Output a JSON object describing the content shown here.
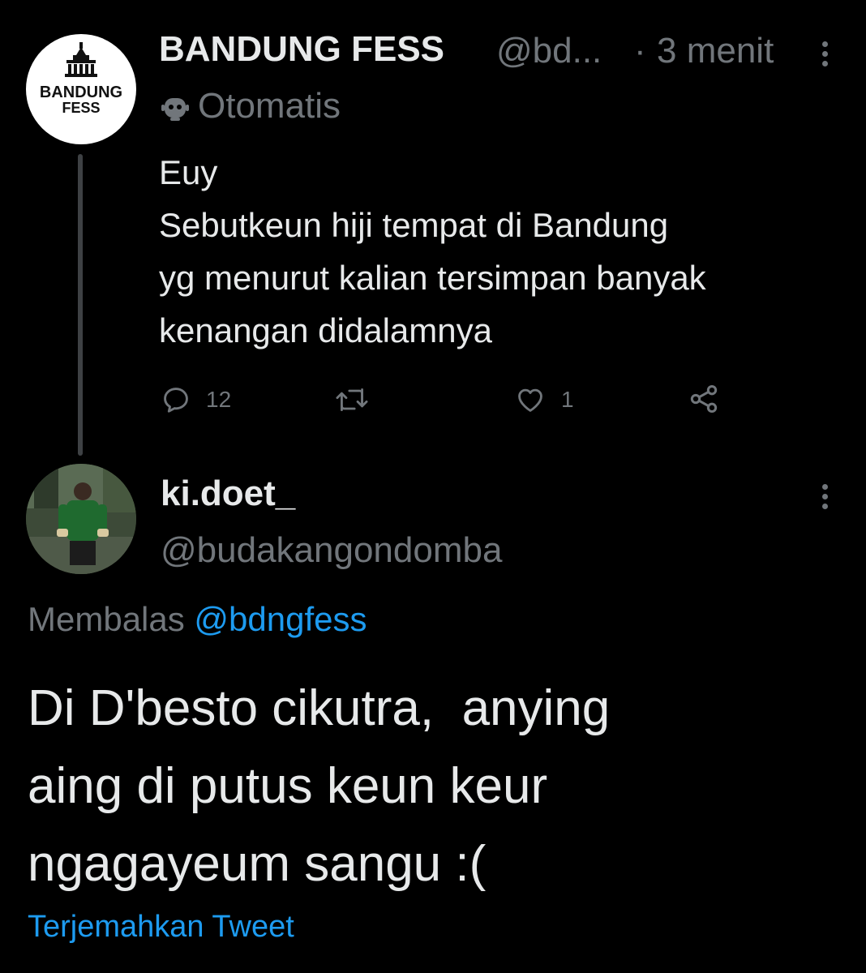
{
  "parent_tweet": {
    "author": {
      "name": "BANDUNG FESS",
      "handle": "@bd...",
      "avatar_text_line1": "BANDUNG",
      "avatar_text_line2": "FESS"
    },
    "separator": "·",
    "time": "3 menit",
    "automated": {
      "icon": "bot-icon",
      "label": "Otomatis"
    },
    "text_lines": [
      "Euy",
      "Sebutkeun hiji tempat di Bandung",
      "yg menurut kalian tersimpan banyak",
      "kenangan didalamnya"
    ],
    "actions": {
      "reply": {
        "icon": "reply-icon",
        "count": "12"
      },
      "retweet": {
        "icon": "retweet-icon",
        "count": ""
      },
      "like": {
        "icon": "heart-icon",
        "count": "1"
      },
      "share": {
        "icon": "share-icon"
      }
    }
  },
  "reply_tweet": {
    "author": {
      "name": "ki.doet_",
      "handle": "@budakangondomba"
    },
    "replying_to": {
      "prefix": "Membalas",
      "mention": "@bdngfess"
    },
    "text_lines": [
      "Di D'besto cikutra,  anying",
      "aing di putus keun keur",
      "ngagayeum sangu :("
    ],
    "translate_label": "Terjemahkan Tweet"
  },
  "colors": {
    "background": "#000000",
    "text_primary": "#e7e9ea",
    "text_secondary": "#71767b",
    "accent": "#1d9bf0",
    "thread_line": "#3e4144"
  }
}
